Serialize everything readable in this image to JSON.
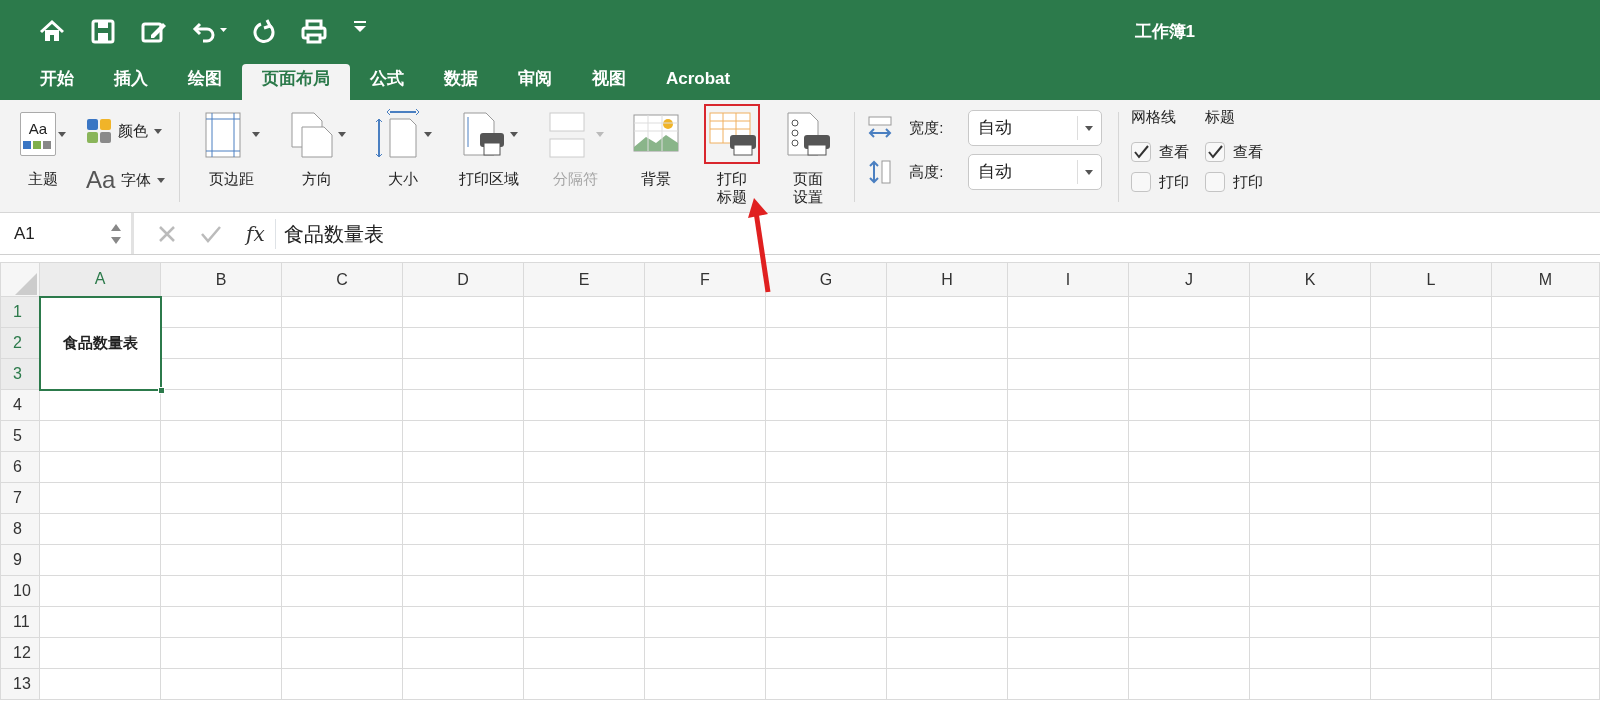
{
  "window": {
    "title": "工作簿1"
  },
  "tabs": [
    {
      "label": "开始",
      "selected": false
    },
    {
      "label": "插入",
      "selected": false
    },
    {
      "label": "绘图",
      "selected": false
    },
    {
      "label": "页面布局",
      "selected": true
    },
    {
      "label": "公式",
      "selected": false
    },
    {
      "label": "数据",
      "selected": false
    },
    {
      "label": "审阅",
      "selected": false
    },
    {
      "label": "视图",
      "selected": false
    },
    {
      "label": "Acrobat",
      "selected": false
    }
  ],
  "ribbon": {
    "themes": {
      "label": "主题",
      "glyph": "Aa"
    },
    "theme_options": [
      {
        "label": "颜色",
        "kind": "colors"
      },
      {
        "label": "字体",
        "kind": "fonts",
        "glyph": "Aa"
      }
    ],
    "page_setup": [
      {
        "label": "页边距",
        "dropdown": true,
        "disabled": false,
        "highlighted": false
      },
      {
        "label": "方向",
        "dropdown": true,
        "disabled": false,
        "highlighted": false
      },
      {
        "label": "大小",
        "dropdown": true,
        "disabled": false,
        "highlighted": false
      },
      {
        "label": "打印区域",
        "dropdown": true,
        "disabled": false,
        "highlighted": false
      },
      {
        "label": "分隔符",
        "dropdown": true,
        "disabled": true,
        "highlighted": false
      },
      {
        "label": "背景",
        "dropdown": false,
        "disabled": false,
        "highlighted": false
      },
      {
        "label": "打印标题",
        "dropdown": false,
        "disabled": false,
        "highlighted": true
      },
      {
        "label": "页面设置",
        "dropdown": false,
        "disabled": false,
        "highlighted": false
      }
    ],
    "scale": [
      {
        "label": "宽度:",
        "value": "自动"
      },
      {
        "label": "高度:",
        "value": "自动"
      }
    ],
    "sheet_options": [
      {
        "heading": "网格线",
        "options": [
          {
            "label": "查看",
            "checked": true
          },
          {
            "label": "打印",
            "checked": false
          }
        ]
      },
      {
        "heading": "标题",
        "options": [
          {
            "label": "查看",
            "checked": true
          },
          {
            "label": "打印",
            "checked": false
          }
        ]
      }
    ]
  },
  "formula_bar": {
    "name_box": "A1",
    "fx_label": "fx",
    "content": "食品数量表"
  },
  "sheet": {
    "columns": [
      {
        "label": "A",
        "selected": true
      },
      {
        "label": "B",
        "selected": false
      },
      {
        "label": "C",
        "selected": false
      },
      {
        "label": "D",
        "selected": false
      },
      {
        "label": "E",
        "selected": false
      },
      {
        "label": "F",
        "selected": false
      },
      {
        "label": "G",
        "selected": false
      },
      {
        "label": "H",
        "selected": false
      },
      {
        "label": "I",
        "selected": false
      },
      {
        "label": "J",
        "selected": false
      },
      {
        "label": "K",
        "selected": false
      },
      {
        "label": "L",
        "selected": false
      },
      {
        "label": "M",
        "selected": false
      }
    ],
    "rows": [
      {
        "label": "1",
        "selected": true
      },
      {
        "label": "2",
        "selected": true
      },
      {
        "label": "3",
        "selected": true
      },
      {
        "label": "4",
        "selected": false
      },
      {
        "label": "5",
        "selected": false
      },
      {
        "label": "6",
        "selected": false
      },
      {
        "label": "7",
        "selected": false
      },
      {
        "label": "8",
        "selected": false
      },
      {
        "label": "9",
        "selected": false
      },
      {
        "label": "10",
        "selected": false
      },
      {
        "label": "11",
        "selected": false
      },
      {
        "label": "12",
        "selected": false
      },
      {
        "label": "13",
        "selected": false
      }
    ],
    "merged_cell": {
      "text": "食品数量表"
    }
  }
}
